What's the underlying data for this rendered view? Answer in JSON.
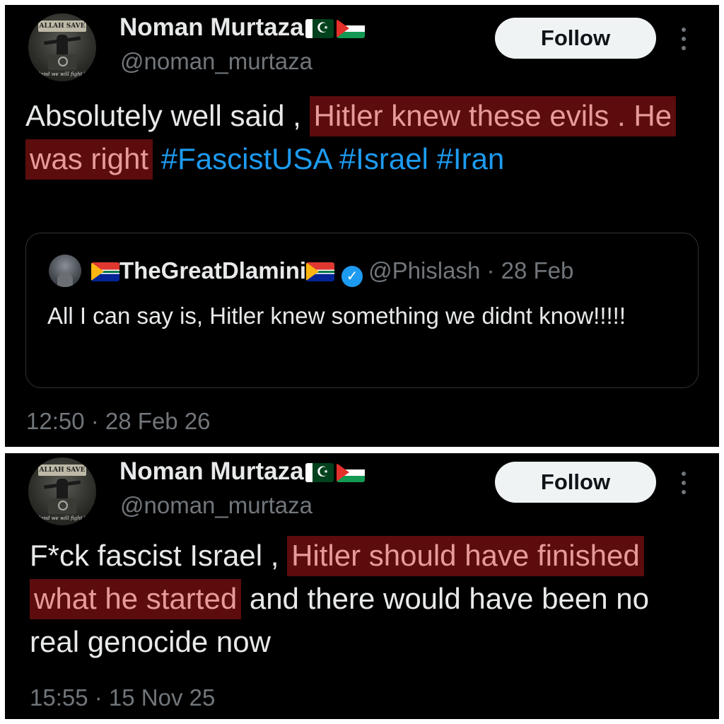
{
  "tweets": [
    {
      "author": {
        "display_name": "Noman Murtaza",
        "flags": [
          "pakistan-flag",
          "palestine-flag"
        ],
        "handle": "@noman_murtaza",
        "avatar_caption": "\"and we will fight.\"",
        "avatar_banner": "ALLAH SAVE"
      },
      "follow_label": "Follow",
      "text_plain_1": "Absolutely well said , ",
      "text_highlight": "Hitler knew these evils . He was right",
      "hashtags": [
        "#FascistUSA",
        "#Israel",
        "#Iran"
      ],
      "quote": {
        "display_name": "TheGreatDlamini",
        "flags": [
          "south-africa-flag",
          "south-africa-flag"
        ],
        "verified": true,
        "handle": "@Phislash",
        "separator": " · ",
        "date": "28 Feb",
        "text": "All I can say is, Hitler knew something we didnt know!!!!!"
      },
      "timestamp": "12:50 · 28 Feb 26"
    },
    {
      "author": {
        "display_name": "Noman Murtaza",
        "flags": [
          "pakistan-flag",
          "palestine-flag"
        ],
        "handle": "@noman_murtaza",
        "avatar_caption": "\"and we will fight.\"",
        "avatar_banner": "ALLAH SAVE"
      },
      "follow_label": "Follow",
      "text_plain_1": "F*ck fascist Israel , ",
      "text_highlight": "Hitler should have finished what he started",
      "text_plain_2": " and there would have been no real genocide now",
      "timestamp": "15:55 · 15 Nov 25"
    }
  ],
  "colors": {
    "background": "#000000",
    "text_primary": "#e7e9ea",
    "text_secondary": "#71767b",
    "hashtag": "#1d9bf0",
    "highlight_bg": "#5c0c0c",
    "highlight_text": "#e79a9a",
    "follow_button_bg": "#eff3f4",
    "verified_badge": "#1d9bf0"
  },
  "icons": {
    "more": "more-vertical-icon",
    "verified": "verified-badge-icon"
  }
}
